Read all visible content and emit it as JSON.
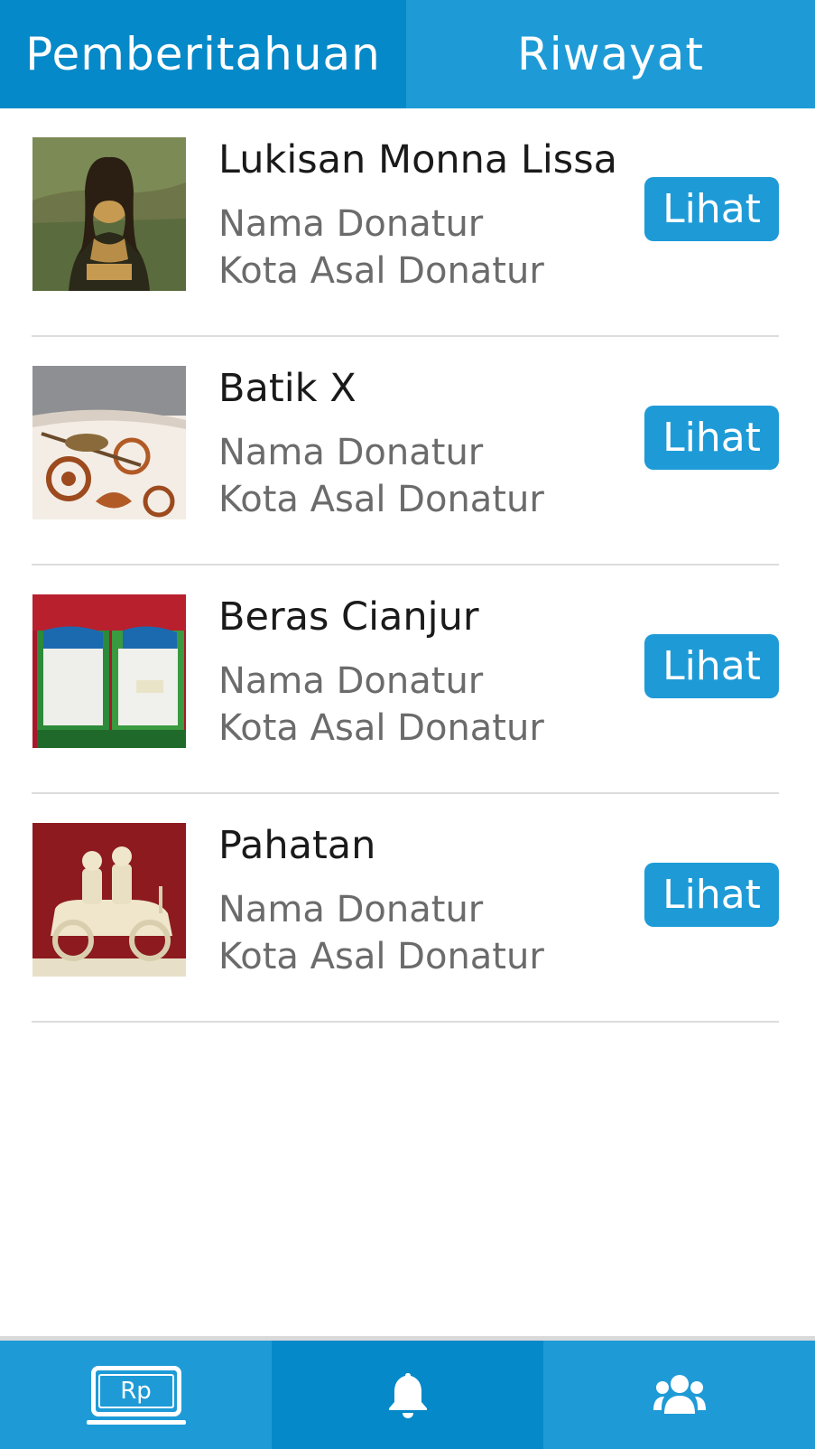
{
  "tabs": {
    "notifications": "Pemberitahuan",
    "history": "Riwayat"
  },
  "items": [
    {
      "title": "Lukisan Monna Lissa",
      "donor": "Nama Donatur",
      "city": "Kota Asal Donatur",
      "button": "Lihat",
      "image_icon": "mona-lisa-painting"
    },
    {
      "title": "Batik X",
      "donor": "Nama Donatur",
      "city": "Kota Asal Donatur",
      "button": "Lihat",
      "image_icon": "batik-fabric"
    },
    {
      "title": "Beras Cianjur",
      "donor": "Nama Donatur",
      "city": "Kota Asal Donatur",
      "button": "Lihat",
      "image_icon": "rice-bags"
    },
    {
      "title": "Pahatan",
      "donor": "Nama Donatur",
      "city": "Kota Asal Donatur",
      "button": "Lihat",
      "image_icon": "car-carving"
    }
  ],
  "bottom_nav": {
    "donation_label": "Rp",
    "donation_icon": "monitor-rp-icon",
    "notification_icon": "bell-icon",
    "community_icon": "users-group-icon"
  },
  "colors": {
    "primary": "#1e9bd7",
    "primary_dark": "#0589c8",
    "title_text": "#1a1a1a",
    "sub_text": "#6b6b6b",
    "divider": "#dcdcdc"
  }
}
